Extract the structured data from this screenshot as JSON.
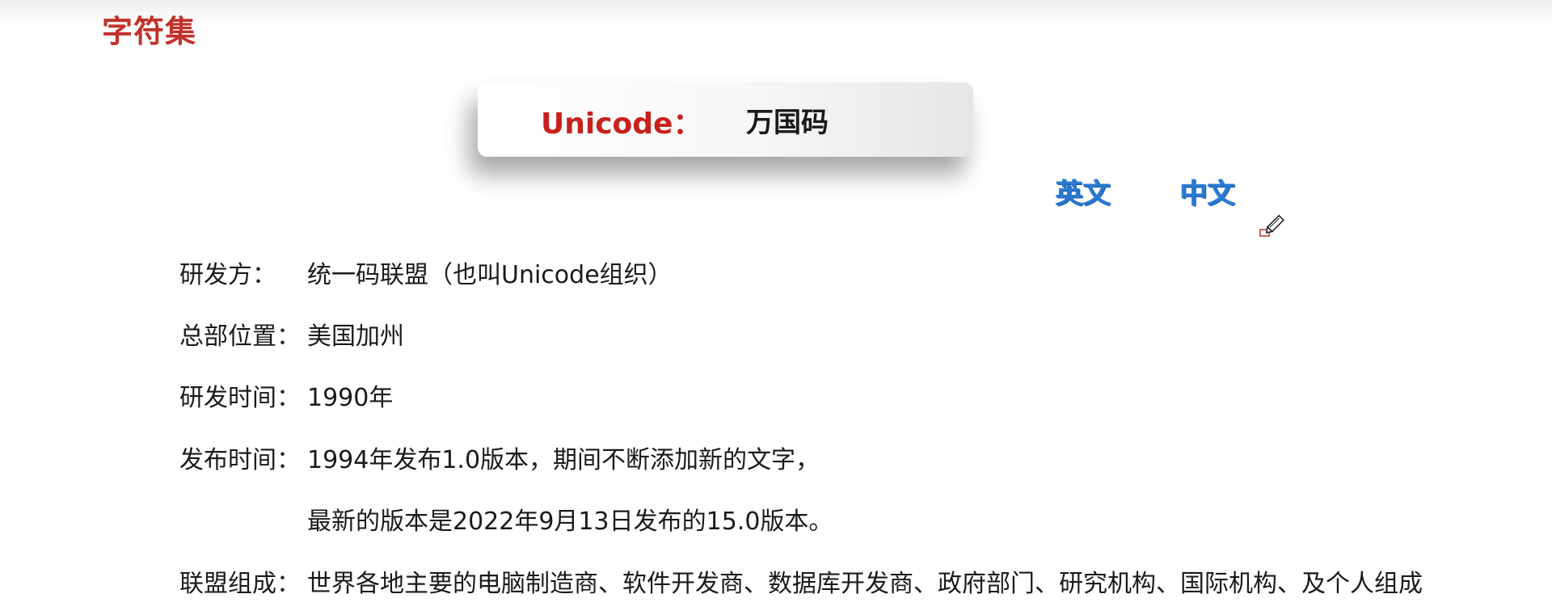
{
  "section_title": "字符集",
  "unicode_card": {
    "label": "Unicode：",
    "value": "万国码"
  },
  "lang_tags": {
    "english": "英文",
    "chinese": "中文"
  },
  "info": {
    "developer": {
      "key": "研发方：",
      "value": "统一码联盟（也叫Unicode组织）"
    },
    "headquarters": {
      "key": "总部位置：",
      "value": "美国加州"
    },
    "dev_time": {
      "key": "研发时间：",
      "value": "1990年"
    },
    "release": {
      "key": "发布时间：",
      "value_line1": "1994年发布1.0版本，期间不断添加新的文字，",
      "value_line2": "最新的版本是2022年9月13日发布的15.0版本。"
    },
    "members": {
      "key": "联盟组成：",
      "value": "世界各地主要的电脑制造商、软件开发商、数据库开发商、政府部门、研究机构、国际机构、及个人组成"
    }
  },
  "colors": {
    "title_red": "#c0322b",
    "unicode_red": "#c8201c",
    "tag_blue": "#2a78d0",
    "text": "#1a1a1a"
  },
  "icons": {
    "cursor": "pencil-cursor-icon"
  }
}
